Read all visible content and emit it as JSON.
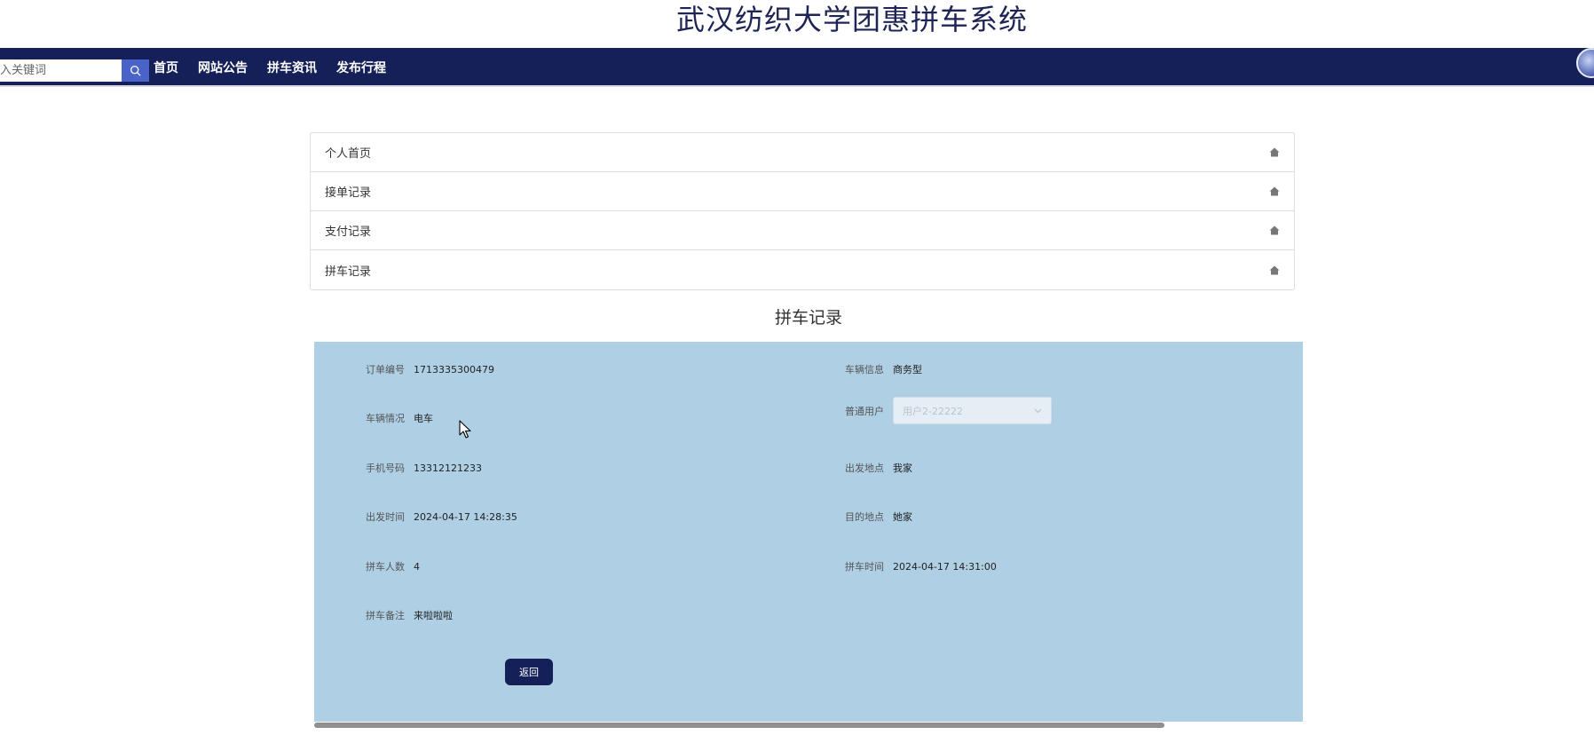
{
  "header": {
    "title": "武汉纺织大学团惠拼车系统"
  },
  "navbar": {
    "search_placeholder": "入关键词",
    "items": [
      "首页",
      "网站公告",
      "拼车资讯",
      "发布行程"
    ]
  },
  "menu": {
    "items": [
      {
        "label": "个人首页",
        "icon": "home-icon"
      },
      {
        "label": "接单记录",
        "icon": "home-icon"
      },
      {
        "label": "支付记录",
        "icon": "home-icon"
      },
      {
        "label": "拼车记录",
        "icon": "home-icon"
      }
    ]
  },
  "section": {
    "title": "拼车记录"
  },
  "detail": {
    "order_no": {
      "label": "订单编号",
      "value": "1713335300479"
    },
    "vehicle_info": {
      "label": "车辆信息",
      "value": "商务型"
    },
    "vehicle_status": {
      "label": "车辆情况",
      "value": "电车"
    },
    "user": {
      "label": "普通用户",
      "value": "用户2-22222"
    },
    "phone": {
      "label": "手机号码",
      "value": "13312121233"
    },
    "departure_place": {
      "label": "出发地点",
      "value": "我家"
    },
    "departure_time": {
      "label": "出发时间",
      "value": "2024-04-17 14:28:35"
    },
    "destination": {
      "label": "目的地点",
      "value": "她家"
    },
    "passengers": {
      "label": "拼车人数",
      "value": "4"
    },
    "carpool_time": {
      "label": "拼车时间",
      "value": "2024-04-17 14:31:00"
    },
    "remark": {
      "label": "拼车备注",
      "value": "来啦啦啦"
    },
    "back_button": "返回"
  },
  "colors": {
    "nav_bg": "#162058",
    "search_button": "#4a63c9",
    "panel_bg": "#aecfe4",
    "title_color": "#1e2555"
  }
}
